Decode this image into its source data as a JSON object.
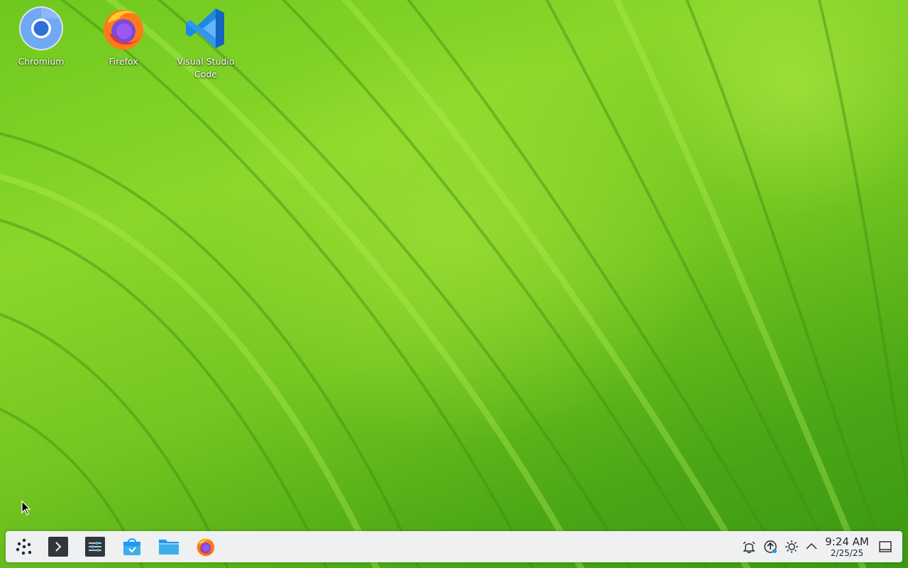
{
  "desktop": {
    "icons": [
      {
        "label": "Chromium",
        "icon": "chromium-icon"
      },
      {
        "label": "Firefox",
        "icon": "firefox-icon"
      },
      {
        "label": "Visual Studio Code",
        "icon": "vscode-icon"
      }
    ],
    "wallpaper": "green-leaf",
    "accent_colors": {
      "leaf_light": "#9ae03a",
      "leaf_dark": "#3b9912"
    }
  },
  "taskbar": {
    "launchers": [
      {
        "icon": "application-launcher-icon"
      },
      {
        "icon": "terminal-icon"
      },
      {
        "icon": "system-settings-icon"
      },
      {
        "icon": "software-store-icon"
      },
      {
        "icon": "file-manager-icon"
      },
      {
        "icon": "firefox-icon"
      }
    ],
    "tray": [
      {
        "icon": "notifications-icon"
      },
      {
        "icon": "updates-icon"
      },
      {
        "icon": "brightness-icon"
      },
      {
        "icon": "show-hidden-icons-chevron"
      }
    ],
    "clock": {
      "time": "9:24 AM",
      "date": "2/25/25"
    },
    "show_desktop": {
      "icon": "show-desktop-icon"
    }
  }
}
